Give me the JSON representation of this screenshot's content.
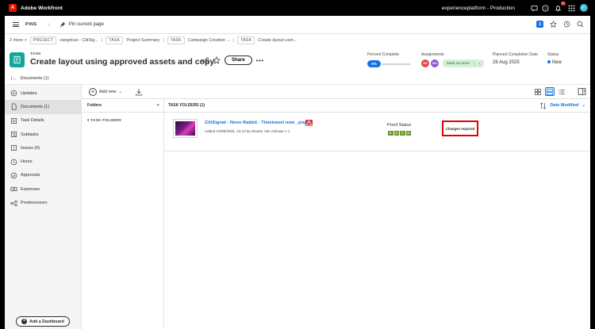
{
  "app": {
    "name": "Adobe Workfront",
    "org": "experienceplatform - Production",
    "notification_count": "9+"
  },
  "nav": {
    "pins_label": "PINS",
    "pin_current": "Pin current page",
    "number_badge": "3"
  },
  "breadcrumb": {
    "more": "2 more",
    "items": [
      {
        "type": "PROJECT",
        "name": "vangeluw - CitiSig..."
      },
      {
        "type": "TASK",
        "name": "Project Summary"
      },
      {
        "type": "TASK",
        "name": "Campaign Creative ..."
      },
      {
        "type": "TASK",
        "name": "Create layout usin..."
      }
    ]
  },
  "task": {
    "type_label": "TASK",
    "title": "Create layout using approved assets and copy",
    "share_label": "Share",
    "percent_complete_label": "Percent Complete",
    "percent_complete": "0%",
    "assignments_label": "Assignments",
    "assignees": [
      {
        "initials": "SG",
        "color": "#e34850"
      },
      {
        "initials": "WG",
        "color": "#9256d9"
      }
    ],
    "mark_done_label": "Mark as done",
    "planned_label": "Planned Completion Date",
    "planned_date": "26 Aug 2025",
    "status_label": "Status",
    "status_value": "New"
  },
  "subbar": {
    "label": "Documents (1)"
  },
  "sidebar": {
    "items": [
      {
        "label": "Updates",
        "icon": "chat-icon",
        "active": false
      },
      {
        "label": "Documents (1)",
        "icon": "document-icon",
        "active": true
      },
      {
        "label": "Task Details",
        "icon": "details-icon",
        "active": false
      },
      {
        "label": "Subtasks",
        "icon": "subtasks-icon",
        "active": false
      },
      {
        "label": "Issues (0)",
        "icon": "issues-icon",
        "active": false
      },
      {
        "label": "Hours",
        "icon": "clock-icon",
        "active": false
      },
      {
        "label": "Approvals",
        "icon": "check-circle-icon",
        "active": false
      },
      {
        "label": "Expenses",
        "icon": "money-icon",
        "active": false
      },
      {
        "label": "Predecessors",
        "icon": "predecessors-icon",
        "active": false
      }
    ],
    "add_dashboard": "Add a Dashboard"
  },
  "toolbar": {
    "add_new": "Add new"
  },
  "folders": {
    "header": "Folders",
    "item": "TASK FOLDERS"
  },
  "content": {
    "header": "TASK FOLDERS (1)",
    "sort_label": "Date Modified",
    "document": {
      "name": "CitiSignal - Neon Rabbit - Timetravel now_.png",
      "meta_prefix": "Added 19/08/2025, 13:13 by Wouter Van Geluwe",
      "likes": "1",
      "proof_status_label": "Proof Status",
      "proof_steps": [
        "S",
        "O",
        "C",
        "D"
      ],
      "proof_decision": "Changes required"
    }
  }
}
